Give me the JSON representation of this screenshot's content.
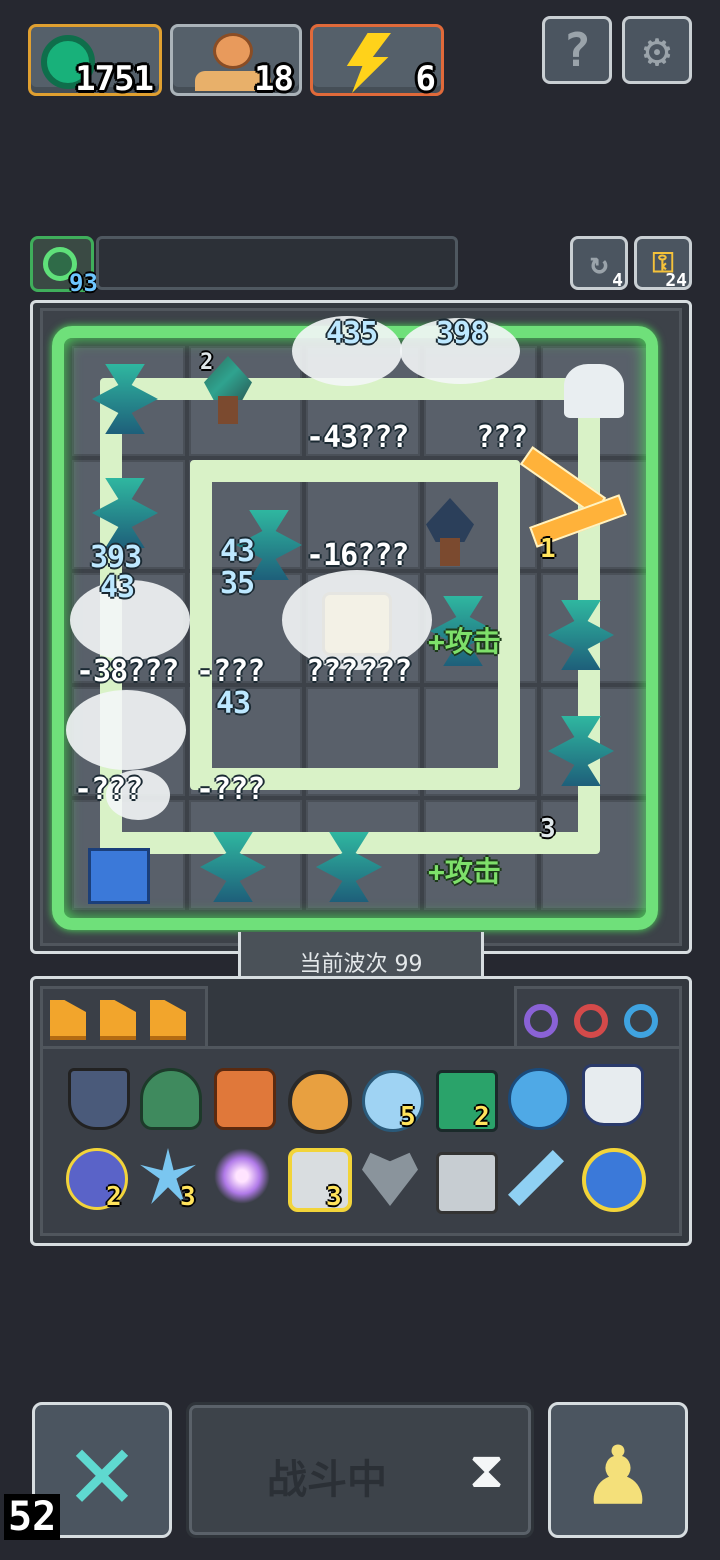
{
  "resources": {
    "coins": "1751",
    "population": "18",
    "energy": "6"
  },
  "top_buttons": {
    "help_label": "?"
  },
  "player": {
    "gem_count": "93"
  },
  "board_counters": {
    "refresh": "4",
    "keys": "24"
  },
  "wave": {
    "label": "当前波次 99"
  },
  "damage_numbers": [
    "435",
    "398",
    "-43???",
    "???",
    "-16???",
    "43",
    "35",
    "393",
    "43",
    "-38???",
    "-???",
    "43",
    "-???",
    "-???",
    "???",
    "???",
    "1",
    "3",
    "2"
  ],
  "buffs": [
    "+攻击",
    "+攻击"
  ],
  "inventory": {
    "slot_levels": [
      "5",
      "2",
      "2",
      "3",
      "3"
    ]
  },
  "bottom": {
    "fight_label": "战斗中",
    "fps": "52"
  },
  "colors": {
    "glow": "#6fe07a",
    "coin_border": "#e0a030",
    "energy_border": "#e06a3a",
    "level_text": "#ffe35c"
  }
}
